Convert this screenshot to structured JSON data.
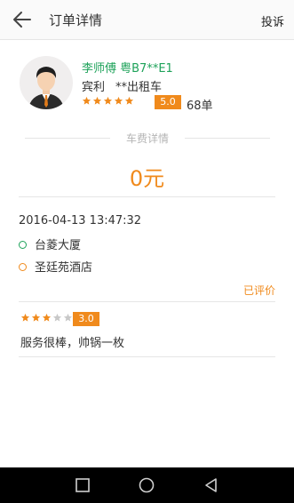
{
  "header": {
    "title": "订单详情",
    "action": "投诉"
  },
  "driver": {
    "name_plate": "李师傅  粤B7**E1",
    "company": "宾利",
    "vehicle": "**出租车",
    "stars": 5,
    "score": "5.0",
    "orders": "68单"
  },
  "fare": {
    "section_label": "车费详情",
    "amount": "0元"
  },
  "trip": {
    "time": "2016-04-13 13:47:32",
    "start": "台菱大厦",
    "end": "圣廷苑酒店",
    "start_color": "#1ea25a",
    "end_color": "#f08a1c"
  },
  "review": {
    "status": "已评价",
    "stars": 3,
    "score": "3.0",
    "comment": "服务很棒，帅锅一枚"
  },
  "colors": {
    "accent": "#f08a1c",
    "green": "#1ea25a"
  },
  "icons": {
    "back": "arrow-left-icon",
    "nav_recent": "square-icon",
    "nav_home": "circle-icon",
    "nav_back": "triangle-icon"
  }
}
